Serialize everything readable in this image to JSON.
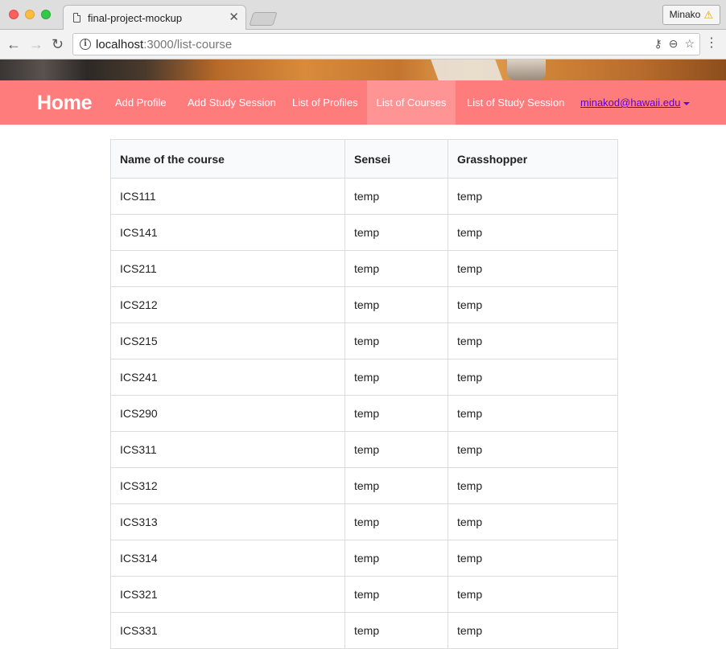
{
  "browser": {
    "tab_title": "final-project-mockup",
    "tab_close": "✕",
    "profile_name": "Minako",
    "url_host": "localhost",
    "url_path": ":3000/list-course"
  },
  "nav": {
    "brand": "Home",
    "items": [
      {
        "label": "Add Profile",
        "active": false
      },
      {
        "label": "Add Study Session",
        "active": false
      },
      {
        "label": "List of Profiles",
        "active": false
      },
      {
        "label": "List of Courses",
        "active": true
      },
      {
        "label": "List of Study Session",
        "active": false
      }
    ],
    "user": "minakod@hawaii.edu"
  },
  "table": {
    "headers": [
      "Name of the course",
      "Sensei",
      "Grasshopper"
    ],
    "rows": [
      [
        "ICS111",
        "temp",
        "temp"
      ],
      [
        "ICS141",
        "temp",
        "temp"
      ],
      [
        "ICS211",
        "temp",
        "temp"
      ],
      [
        "ICS212",
        "temp",
        "temp"
      ],
      [
        "ICS215",
        "temp",
        "temp"
      ],
      [
        "ICS241",
        "temp",
        "temp"
      ],
      [
        "ICS290",
        "temp",
        "temp"
      ],
      [
        "ICS311",
        "temp",
        "temp"
      ],
      [
        "ICS312",
        "temp",
        "temp"
      ],
      [
        "ICS313",
        "temp",
        "temp"
      ],
      [
        "ICS314",
        "temp",
        "temp"
      ],
      [
        "ICS321",
        "temp",
        "temp"
      ],
      [
        "ICS331",
        "temp",
        "temp"
      ]
    ]
  },
  "colors": {
    "nav_bg": "#fe7c7c",
    "nav_active_bg": "#fe9494",
    "user_link": "#6000d8"
  }
}
